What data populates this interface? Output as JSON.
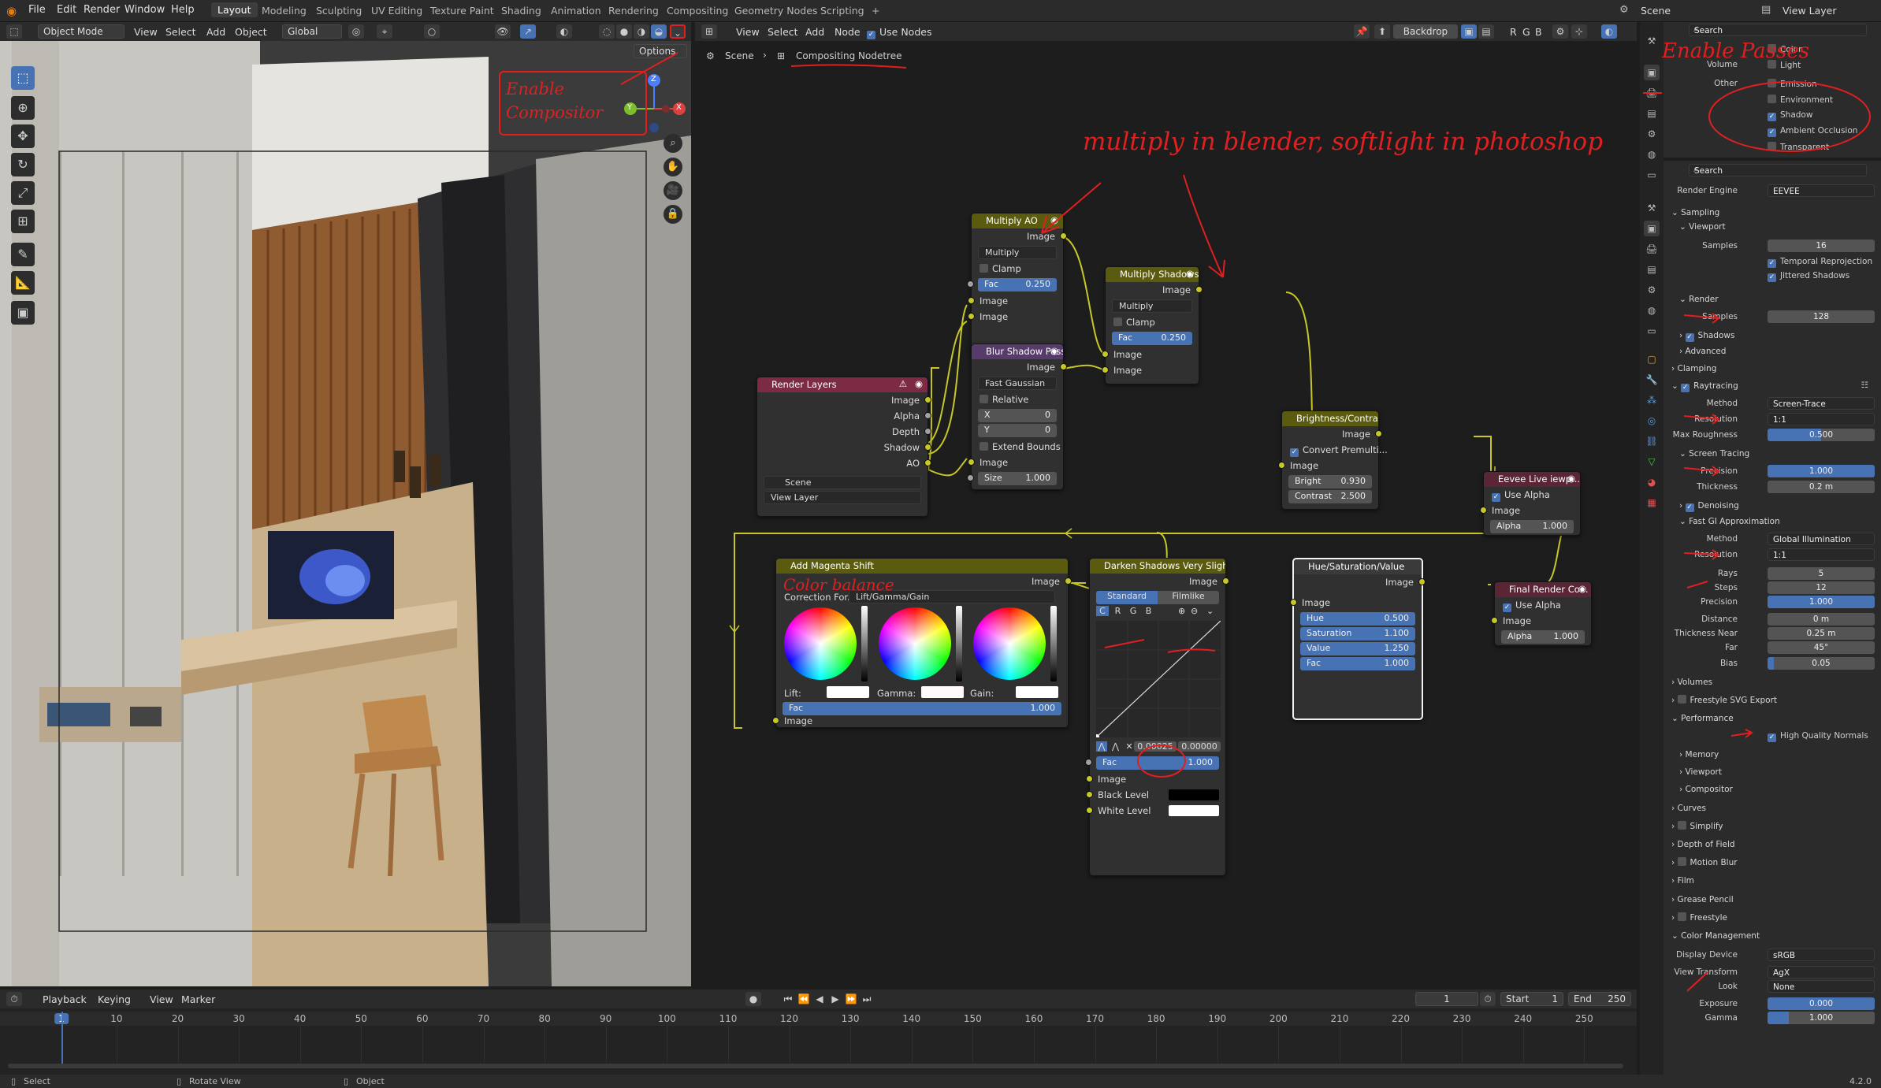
{
  "topbar": {
    "menus": [
      "File",
      "Edit",
      "Render",
      "Window",
      "Help"
    ],
    "workspaces": [
      "Layout",
      "Modeling",
      "Sculpting",
      "UV Editing",
      "Texture Paint",
      "Shading",
      "Animation",
      "Rendering",
      "Compositing",
      "Geometry Nodes",
      "Scripting"
    ],
    "active_workspace": "Layout",
    "scene": "Scene",
    "view_layer": "View Layer",
    "add_tab": "+"
  },
  "viewport": {
    "mode": "Object Mode",
    "menus": [
      "View",
      "Select",
      "Add",
      "Object"
    ],
    "transform": "Global",
    "options": "Options",
    "gizmo_z": "Z",
    "gizmo_x": "X",
    "gizmo_y": "Y"
  },
  "node_editor": {
    "menus": [
      "View",
      "Select",
      "Add",
      "Node"
    ],
    "use_nodes": "Use Nodes",
    "backdrop": "Backdrop",
    "rgb": [
      "R",
      "G",
      "B"
    ],
    "breadcrumb": [
      "Scene",
      "Compositing Nodetree"
    ],
    "nodes": {
      "render_layers": {
        "title": "Render Layers",
        "outputs": [
          "Image",
          "Alpha",
          "Depth",
          "Shadow",
          "AO"
        ],
        "scene": "Scene",
        "view_layer": "View Layer"
      },
      "multiply_ao": {
        "title": "Multiply AO",
        "out": "Image",
        "mode": "Multiply",
        "clamp": "Clamp",
        "fac_label": "Fac",
        "fac": "0.250",
        "in1": "Image",
        "in2": "Image"
      },
      "blur": {
        "title": "Blur Shadow Pass",
        "out": "Image",
        "type": "Fast Gaussian",
        "relative": "Relative",
        "x_label": "X",
        "x": "0",
        "y_label": "Y",
        "y": "0",
        "extend": "Extend Bounds",
        "in": "Image",
        "size_label": "Size",
        "size": "1.000"
      },
      "multiply_shadows": {
        "title": "Multiply Shadows",
        "out": "Image",
        "mode": "Multiply",
        "clamp": "Clamp",
        "fac_label": "Fac",
        "fac": "0.250",
        "in1": "Image",
        "in2": "Image"
      },
      "brightness": {
        "title": "Brightness/Contrast",
        "out": "Image",
        "convert": "Convert Premulti...",
        "in": "Image",
        "bright_label": "Bright",
        "bright": "0.930",
        "contrast_label": "Contrast",
        "contrast": "2.500"
      },
      "eevee": {
        "title": "Eevee Live iewp...",
        "use_alpha": "Use Alpha",
        "in": "Image",
        "alpha_label": "Alpha",
        "alpha": "1.000"
      },
      "final": {
        "title": "Final Render Co...",
        "use_alpha": "Use Alpha",
        "in": "Image",
        "alpha_label": "Alpha",
        "alpha": "1.000"
      },
      "magenta": {
        "title": "Add Magenta Shift",
        "out": "Image",
        "correction_label": "Correction For...",
        "correction": "Lift/Gamma/Gain",
        "lift": "Lift:",
        "gamma": "Gamma:",
        "gain": "Gain:",
        "fac_label": "Fac",
        "fac": "1.000",
        "in": "Image"
      },
      "darken": {
        "title": "Darken Shadows Very Slightly",
        "out": "Image",
        "tab1": "Standard",
        "tab2": "Filmlike",
        "channels": [
          "C",
          "R",
          "G",
          "B"
        ],
        "pt_x": "0.00025",
        "pt_y": "0.00000",
        "fac_label": "Fac",
        "fac": "1.000",
        "in": "Image",
        "black": "Black Level",
        "white": "White Level"
      },
      "hsv": {
        "title": "Hue/Saturation/Value",
        "out": "Image",
        "in": "Image",
        "hue_label": "Hue",
        "hue": "0.500",
        "sat_label": "Saturation",
        "sat": "1.100",
        "val_label": "Value",
        "val": "1.250",
        "fac_label": "Fac",
        "fac": "1.000"
      }
    }
  },
  "annotations": {
    "enable_compositor": "Enable Compositor",
    "multiply": "multiply in blender, softlight in photoshop",
    "color_balance": "Color balance",
    "enable_passes": "Enable Passes"
  },
  "passes": {
    "volume": "Volume",
    "light": "Light",
    "color": "Color",
    "other": "Other",
    "items": [
      {
        "label": "Emission",
        "on": false
      },
      {
        "label": "Environment",
        "on": false
      },
      {
        "label": "Shadow",
        "on": true
      },
      {
        "label": "Ambient Occlusion",
        "on": true
      },
      {
        "label": "Transparent",
        "on": false
      }
    ],
    "search": "Search"
  },
  "render": {
    "search": "Search",
    "engine_label": "Render Engine",
    "engine": "EEVEE",
    "sampling": "Sampling",
    "viewport": "Viewport",
    "samples_label": "Samples",
    "viewport_samples": "16",
    "temporal": "Temporal Reprojection",
    "jittered": "Jittered Shadows",
    "render": "Render",
    "render_samples": "128",
    "shadows": "Shadows",
    "advanced": "Advanced",
    "clamping": "Clamping",
    "raytracing": "Raytracing",
    "method_label": "Method",
    "method": "Screen-Trace",
    "resolution_label": "Resolution",
    "resolution": "1:1",
    "max_rough_label": "Max Roughness",
    "max_rough": "0.500",
    "screen_tracing": "Screen Tracing",
    "precision_label": "Precision",
    "precision": "1.000",
    "thickness_label": "Thickness",
    "thickness": "0.2 m",
    "denoising": "Denoising",
    "fast_gi": "Fast GI Approximation",
    "gi_method": "Global Illumination",
    "gi_resolution": "1:1",
    "rays_label": "Rays",
    "rays": "5",
    "steps_label": "Steps",
    "steps": "12",
    "gi_precision": "1.000",
    "distance_label": "Distance",
    "distance": "0 m",
    "thick_near_label": "Thickness Near",
    "thick_near": "0.25 m",
    "far_label": "Far",
    "far": "45°",
    "bias_label": "Bias",
    "bias": "0.05",
    "volumes": "Volumes",
    "freestyle_svg": "Freestyle SVG Export",
    "performance": "Performance",
    "hq_normals": "High Quality Normals",
    "memory": "Memory",
    "perf_viewport": "Viewport",
    "compositor": "Compositor",
    "curves": "Curves",
    "simplify": "Simplify",
    "dof": "Depth of Field",
    "motion_blur": "Motion Blur",
    "film": "Film",
    "grease_pencil": "Grease Pencil",
    "freestyle": "Freestyle",
    "color_mgmt": "Color Management",
    "display_label": "Display Device",
    "display": "sRGB",
    "view_label": "View Transform",
    "view": "AgX",
    "look_label": "Look",
    "look": "None",
    "exposure_label": "Exposure",
    "exposure": "0.000",
    "gamma_label": "Gamma",
    "gamma": "1.000"
  },
  "timeline": {
    "menus": [
      "Playback",
      "Keying",
      "View",
      "Marker"
    ],
    "current": "1",
    "start_label": "Start",
    "start": "1",
    "end_label": "End",
    "end": "250",
    "ticks": [
      "1",
      "10",
      "20",
      "30",
      "40",
      "50",
      "60",
      "70",
      "80",
      "90",
      "100",
      "110",
      "120",
      "130",
      "140",
      "150",
      "160",
      "170",
      "180",
      "190",
      "200",
      "210",
      "220",
      "230",
      "240",
      "250"
    ]
  },
  "status": {
    "select": "Select",
    "rotate": "Rotate View",
    "object": "Object",
    "version": "4.2.0"
  },
  "colors": {
    "accent": "#4772b3",
    "annotation": "#e02020",
    "socket_color": "#c7c729",
    "socket_gray": "#a1a1a1",
    "noodle": "#c7c729"
  }
}
